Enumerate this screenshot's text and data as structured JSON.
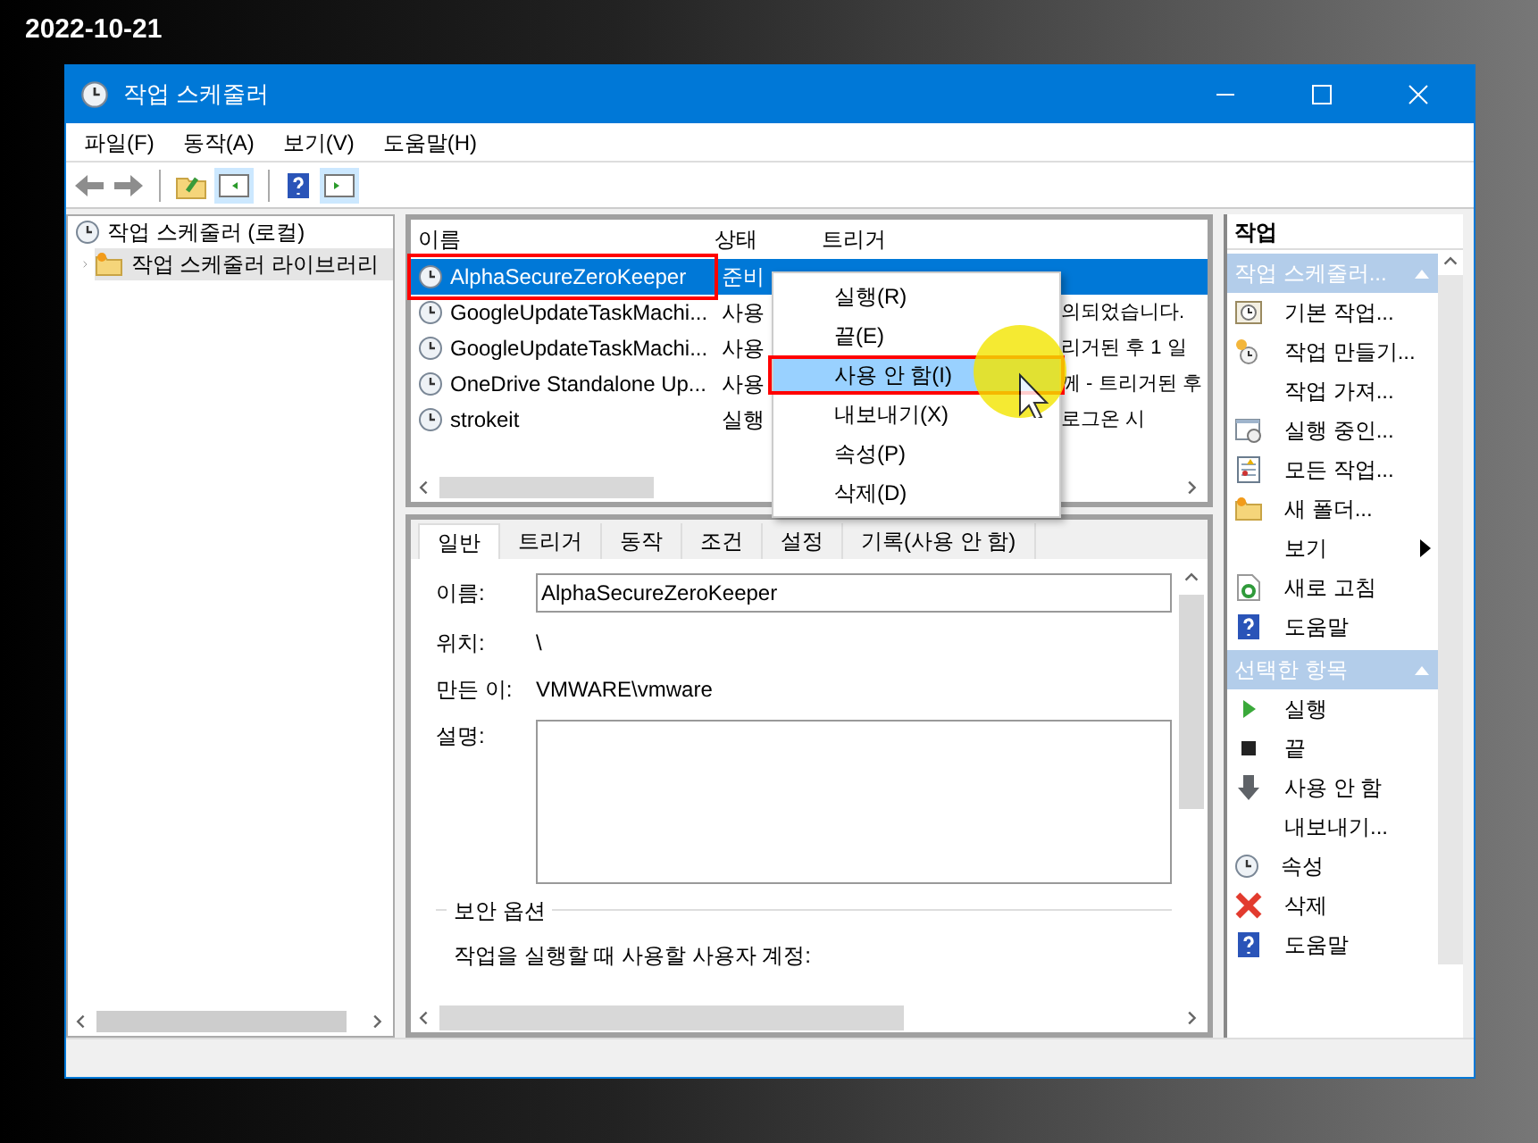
{
  "date": "2022-10-21",
  "window": {
    "title": "작업 스케줄러"
  },
  "menu": [
    "파일(F)",
    "동작(A)",
    "보기(V)",
    "도움말(H)"
  ],
  "tree": [
    {
      "label": "작업 스케줄러 (로컬)",
      "children": [
        {
          "label": "작업 스케줄러 라이브러리",
          "expanded": false,
          "selected": true
        }
      ]
    }
  ],
  "table": {
    "columns": [
      "이름",
      "상태",
      "트리거"
    ],
    "rows": [
      {
        "name": "AlphaSecureZeroKeeper",
        "status": "준비",
        "trigger": "",
        "selected": true
      },
      {
        "name": "GoogleUpdateTaskMachi...",
        "status": "사용",
        "trigger": "의되었습니다.",
        "selected": false
      },
      {
        "name": "GoogleUpdateTaskMachi...",
        "status": "사용",
        "trigger": "리거된 후 1 일",
        "selected": false
      },
      {
        "name": "OneDrive Standalone Up...",
        "status": "사용",
        "trigger": "께 - 트리거된 후",
        "selected": false
      },
      {
        "name": "strokeit",
        "status": "실행",
        "trigger": "로그온 시",
        "selected": false
      }
    ]
  },
  "context_menu": [
    {
      "label": "실행(R)",
      "selected": false
    },
    {
      "label": "끝(E)",
      "selected": false
    },
    {
      "label": "사용 안 함(I)",
      "selected": true
    },
    {
      "label": "내보내기(X)",
      "selected": false
    },
    {
      "label": "속성(P)",
      "selected": false
    },
    {
      "label": "삭제(D)",
      "selected": false
    }
  ],
  "detail": {
    "tabs": [
      {
        "label": "일반",
        "selected": true
      },
      {
        "label": "트리거",
        "selected": false
      },
      {
        "label": "동작",
        "selected": false
      },
      {
        "label": "조건",
        "selected": false
      },
      {
        "label": "설정",
        "selected": false
      },
      {
        "label": "기록(사용 안 함)",
        "selected": false
      }
    ],
    "name_label": "이름:",
    "name_value": "AlphaSecureZeroKeeper",
    "location_label": "위치:",
    "location_value": "\\",
    "author_label": "만든 이:",
    "author_value": "VMWARE\\vmware",
    "description_label": "설명:",
    "security_group": "보안 옵션",
    "account_label": "작업을 실행할 때 사용할 사용자 계정:"
  },
  "actions": {
    "title": "작업",
    "sections": [
      {
        "title": "작업 스케줄러...",
        "expanded": true,
        "items": [
          {
            "label": "기본 작업...",
            "kind": "wizard"
          },
          {
            "label": "작업 만들기...",
            "kind": "create"
          },
          {
            "label": "작업 가져...",
            "kind": "plain"
          },
          {
            "label": "실행 중인...",
            "kind": "running"
          },
          {
            "label": "모든 작업...",
            "kind": "list"
          },
          {
            "label": "새 폴더...",
            "kind": "folder"
          },
          {
            "label": "보기",
            "kind": "plain",
            "submenu": true
          },
          {
            "label": "새로 고침",
            "kind": "refresh"
          },
          {
            "label": "도움말",
            "kind": "help"
          }
        ]
      },
      {
        "title": "선택한 항목",
        "expanded": true,
        "items": [
          {
            "label": "실행",
            "kind": "run"
          },
          {
            "label": "끝",
            "kind": "stop"
          },
          {
            "label": "사용 안 함",
            "kind": "disable"
          },
          {
            "label": "내보내기...",
            "kind": "plain"
          },
          {
            "label": "속성",
            "kind": "clock"
          },
          {
            "label": "삭제",
            "kind": "delete"
          },
          {
            "label": "도움말",
            "kind": "help"
          }
        ]
      }
    ]
  }
}
